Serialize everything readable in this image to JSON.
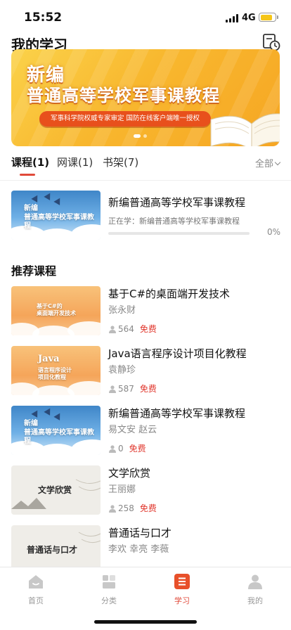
{
  "status_bar": {
    "time": "15:52",
    "network": "4G"
  },
  "header": {
    "title": "我的学习",
    "history_icon": "history-clock-icon"
  },
  "banner": {
    "line1": "新编",
    "line2": "普通高等学校军事课教程",
    "pill": "军事科学院权威专家审定 国防在线客户端唯一授权"
  },
  "tabs": [
    {
      "label": "课程(1)",
      "active": true
    },
    {
      "label": "网课(1)",
      "active": false
    },
    {
      "label": "书架(7)",
      "active": false
    }
  ],
  "filter": {
    "label": "全部"
  },
  "current_course": {
    "thumb_text_1": "新编",
    "thumb_text_2": "普通高等学校军事课教程",
    "title": "新编普通高等学校军事课教程",
    "subtitle": "正在学：新编普通高等学校军事课教程",
    "progress": 0,
    "progress_label": "0%"
  },
  "recommended": {
    "title": "推荐课程",
    "items": [
      {
        "thumb_1": "基于C#的",
        "thumb_2": "桌面端开发技术",
        "title": "基于C#的桌面端开发技术",
        "author": "张永财",
        "learners": "564",
        "price": "免费"
      },
      {
        "thumb_1": "Java",
        "thumb_2": "语言程序设计",
        "thumb_3": "项目化教程",
        "title": "Java语言程序设计项目化教程",
        "author": "袁静珍",
        "learners": "587",
        "price": "免费"
      },
      {
        "thumb_1": "新编",
        "thumb_2": "普通高等学校军事课教程",
        "title": "新编普通高等学校军事课教程",
        "author": "易文安 赵云",
        "learners": "0",
        "price": "免费"
      },
      {
        "thumb_1": "文学欣赏",
        "title": "文学欣赏",
        "author": "王丽娜",
        "learners": "258",
        "price": "免费"
      },
      {
        "thumb_1": "普通话与口才",
        "title": "普通话与口才",
        "author": "李欢 幸亮 李薇",
        "learners": "",
        "price": ""
      }
    ]
  },
  "tabbar": [
    {
      "label": "首页",
      "icon": "home-icon",
      "active": false
    },
    {
      "label": "分类",
      "icon": "category-icon",
      "active": false
    },
    {
      "label": "学习",
      "icon": "study-icon",
      "active": true
    },
    {
      "label": "我的",
      "icon": "profile-icon",
      "active": false
    }
  ],
  "colors": {
    "accent": "#e04a3a",
    "price": "#e0362c",
    "banner": "#f8b72e"
  }
}
